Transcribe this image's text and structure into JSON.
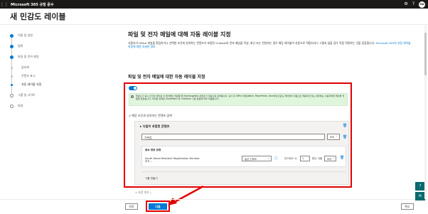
{
  "topbar": {
    "title": "Microsoft 365 규정 준수",
    "gear_icon": "⚙",
    "help_icon": "?",
    "avatar": "MA"
  },
  "page": {
    "title": "새 민감도 레이블"
  },
  "steps": [
    {
      "label": "이름 및 설명",
      "state": "done"
    },
    {
      "label": "범위",
      "state": "done"
    },
    {
      "label": "파일 및 전자 메일",
      "state": "done"
    },
    {
      "label": "암호화",
      "state": "sub"
    },
    {
      "label": "콘텐츠 표시",
      "state": "sub"
    },
    {
      "label": "자동 레이블 지정",
      "state": "current"
    },
    {
      "label": "그룹 및 사이트",
      "state": "todo"
    },
    {
      "label": "마침",
      "state": "todo"
    }
  ],
  "main": {
    "heading": "파일 및 전자 메일에 대해 자동 레이블 지정",
    "desc": "사용자가 Office 파일을 편집하거나 선택한 조건에 일치하는 콘텐츠가 포함된 Outlook의 전자 메일을 작성, 회신 또는 전달하는 경우 해당 레이블이 자동으로 적용되거나 그렇지 않을 경우 직접 적용하는 것을 권장합니다.",
    "desc_link": "Microsoft 365의 자동 레이블 지정에 대한 자세한 정보",
    "subheading": "파일 및 전자 메일에 대한 자동 레이블 지정",
    "info": "업로드가 즉시 인코딩 처리된 이 레이블이 적용될 때 Exchange에서 콘텐츠가 자동으로 검색됩니다. 검사 후 Office 파일(Word, PowerPoint, Excel)에 민감도 레이블이 자동으로 적용되지 않는 경우에는 사용자에게 레이블 적용을 권장합니다. 이러한 정책은 SharePoint 및 OneDrive 기본 설정에 따라 적용됩니다.",
    "section": "해당 조건과 일치하는 콘텐츠 검색",
    "group_title": "다음이 포함된 콘텐츠",
    "group_input": "기본값",
    "group_op": "모두",
    "card_title": "중요 정보 유형",
    "info_type": "South Korea Resident Registration Number",
    "confidence": "높은 신뢰도",
    "count_label": "인스턴스 수",
    "count_min": "1",
    "count_to": "받는 사람",
    "count_max": "모두",
    "card_op": "모두",
    "add_label": "추가",
    "create_group": "그룹 만들기",
    "add_condition": "조건 추가"
  },
  "footer": {
    "back": "뒤로",
    "next": "다음",
    "cancel": "취소"
  }
}
